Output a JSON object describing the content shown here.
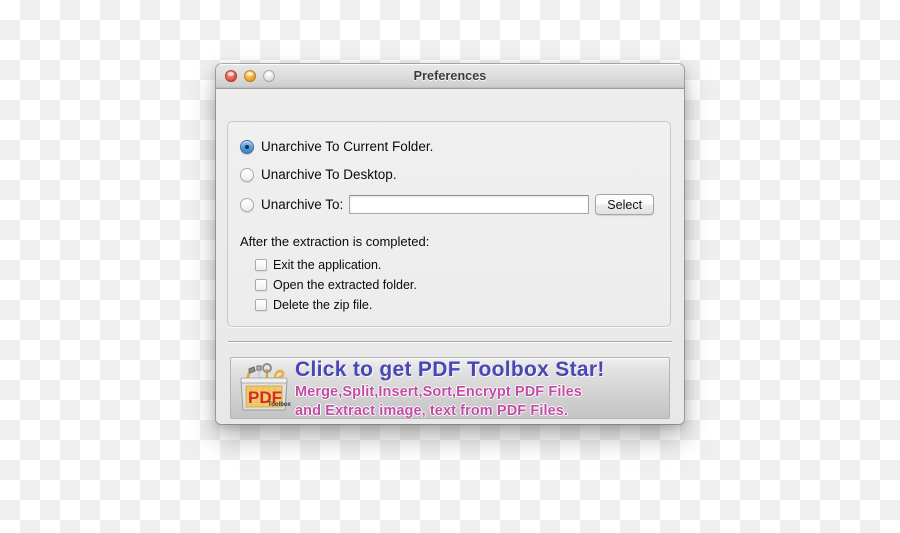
{
  "window": {
    "title": "Preferences",
    "controls": {
      "close": "close-button",
      "minimize": "minimize-button",
      "zoom": "zoom-button"
    }
  },
  "preferences": {
    "destination_options": [
      {
        "id": "current-folder",
        "label": "Unarchive To Current Folder.",
        "selected": true
      },
      {
        "id": "desktop",
        "label": "Unarchive To Desktop.",
        "selected": false
      },
      {
        "id": "custom",
        "label": "Unarchive To:",
        "selected": false
      }
    ],
    "path_field": {
      "value": "",
      "placeholder": ""
    },
    "select_button": {
      "label": "Select"
    },
    "after_extraction": {
      "heading": "After the extraction is completed:",
      "options": [
        {
          "id": "exit-app",
          "label": "Exit the application.",
          "checked": false
        },
        {
          "id": "open-folder",
          "label": "Open the extracted folder.",
          "checked": false
        },
        {
          "id": "delete-zip",
          "label": "Delete the zip file.",
          "checked": false
        }
      ]
    }
  },
  "banner": {
    "icon_name": "pdf-toolbox-icon",
    "icon_caption": "PDF",
    "icon_subcaption": "Toolbox",
    "title": "Click to get PDF Toolbox Star!",
    "subtitle_line1": "Merge,Split,Insert,Sort,Encrypt PDF Files",
    "subtitle_line2": "and Extract image, text from PDF Files."
  },
  "colors": {
    "banner_title": "#4a46b4",
    "banner_subtitle": "#c24ba6",
    "radio_selected": "#5a9fdc",
    "window_chrome": "#ececec",
    "close_light": "#e56258",
    "minimize_light": "#f0ac3c",
    "zoom_light": "#e4e4e4"
  }
}
